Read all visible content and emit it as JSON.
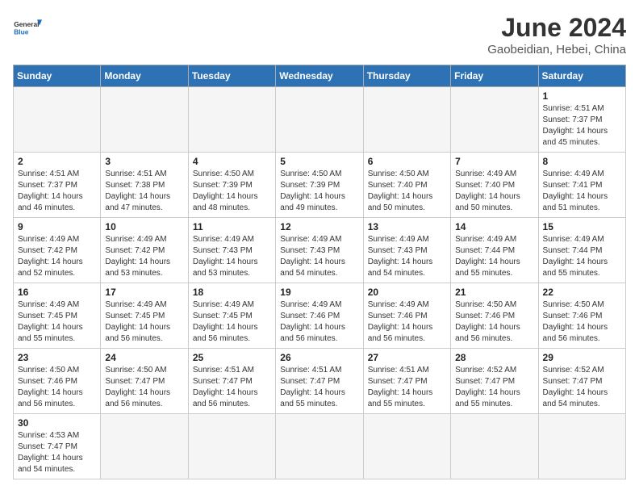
{
  "header": {
    "logo_general": "General",
    "logo_blue": "Blue",
    "title": "June 2024",
    "subtitle": "Gaobeidian, Hebei, China"
  },
  "days_of_week": [
    "Sunday",
    "Monday",
    "Tuesday",
    "Wednesday",
    "Thursday",
    "Friday",
    "Saturday"
  ],
  "weeks": [
    [
      {
        "day": "",
        "empty": true
      },
      {
        "day": "",
        "empty": true
      },
      {
        "day": "",
        "empty": true
      },
      {
        "day": "",
        "empty": true
      },
      {
        "day": "",
        "empty": true
      },
      {
        "day": "",
        "empty": true
      },
      {
        "day": "1",
        "sunrise": "4:51 AM",
        "sunset": "7:37 PM",
        "daylight": "14 hours and 45 minutes."
      }
    ],
    [
      {
        "day": "2",
        "sunrise": "4:51 AM",
        "sunset": "7:37 PM",
        "daylight": "14 hours and 46 minutes."
      },
      {
        "day": "3",
        "sunrise": "4:51 AM",
        "sunset": "7:38 PM",
        "daylight": "14 hours and 47 minutes."
      },
      {
        "day": "4",
        "sunrise": "4:50 AM",
        "sunset": "7:39 PM",
        "daylight": "14 hours and 48 minutes."
      },
      {
        "day": "5",
        "sunrise": "4:50 AM",
        "sunset": "7:39 PM",
        "daylight": "14 hours and 49 minutes."
      },
      {
        "day": "6",
        "sunrise": "4:50 AM",
        "sunset": "7:40 PM",
        "daylight": "14 hours and 50 minutes."
      },
      {
        "day": "7",
        "sunrise": "4:49 AM",
        "sunset": "7:40 PM",
        "daylight": "14 hours and 50 minutes."
      },
      {
        "day": "8",
        "sunrise": "4:49 AM",
        "sunset": "7:41 PM",
        "daylight": "14 hours and 51 minutes."
      }
    ],
    [
      {
        "day": "9",
        "sunrise": "4:49 AM",
        "sunset": "7:42 PM",
        "daylight": "14 hours and 52 minutes."
      },
      {
        "day": "10",
        "sunrise": "4:49 AM",
        "sunset": "7:42 PM",
        "daylight": "14 hours and 53 minutes."
      },
      {
        "day": "11",
        "sunrise": "4:49 AM",
        "sunset": "7:43 PM",
        "daylight": "14 hours and 53 minutes."
      },
      {
        "day": "12",
        "sunrise": "4:49 AM",
        "sunset": "7:43 PM",
        "daylight": "14 hours and 54 minutes."
      },
      {
        "day": "13",
        "sunrise": "4:49 AM",
        "sunset": "7:43 PM",
        "daylight": "14 hours and 54 minutes."
      },
      {
        "day": "14",
        "sunrise": "4:49 AM",
        "sunset": "7:44 PM",
        "daylight": "14 hours and 55 minutes."
      },
      {
        "day": "15",
        "sunrise": "4:49 AM",
        "sunset": "7:44 PM",
        "daylight": "14 hours and 55 minutes."
      }
    ],
    [
      {
        "day": "16",
        "sunrise": "4:49 AM",
        "sunset": "7:45 PM",
        "daylight": "14 hours and 55 minutes."
      },
      {
        "day": "17",
        "sunrise": "4:49 AM",
        "sunset": "7:45 PM",
        "daylight": "14 hours and 56 minutes."
      },
      {
        "day": "18",
        "sunrise": "4:49 AM",
        "sunset": "7:45 PM",
        "daylight": "14 hours and 56 minutes."
      },
      {
        "day": "19",
        "sunrise": "4:49 AM",
        "sunset": "7:46 PM",
        "daylight": "14 hours and 56 minutes."
      },
      {
        "day": "20",
        "sunrise": "4:49 AM",
        "sunset": "7:46 PM",
        "daylight": "14 hours and 56 minutes."
      },
      {
        "day": "21",
        "sunrise": "4:50 AM",
        "sunset": "7:46 PM",
        "daylight": "14 hours and 56 minutes."
      },
      {
        "day": "22",
        "sunrise": "4:50 AM",
        "sunset": "7:46 PM",
        "daylight": "14 hours and 56 minutes."
      }
    ],
    [
      {
        "day": "23",
        "sunrise": "4:50 AM",
        "sunset": "7:46 PM",
        "daylight": "14 hours and 56 minutes."
      },
      {
        "day": "24",
        "sunrise": "4:50 AM",
        "sunset": "7:47 PM",
        "daylight": "14 hours and 56 minutes."
      },
      {
        "day": "25",
        "sunrise": "4:51 AM",
        "sunset": "7:47 PM",
        "daylight": "14 hours and 56 minutes."
      },
      {
        "day": "26",
        "sunrise": "4:51 AM",
        "sunset": "7:47 PM",
        "daylight": "14 hours and 55 minutes."
      },
      {
        "day": "27",
        "sunrise": "4:51 AM",
        "sunset": "7:47 PM",
        "daylight": "14 hours and 55 minutes."
      },
      {
        "day": "28",
        "sunrise": "4:52 AM",
        "sunset": "7:47 PM",
        "daylight": "14 hours and 55 minutes."
      },
      {
        "day": "29",
        "sunrise": "4:52 AM",
        "sunset": "7:47 PM",
        "daylight": "14 hours and 54 minutes."
      }
    ],
    [
      {
        "day": "30",
        "sunrise": "4:53 AM",
        "sunset": "7:47 PM",
        "daylight": "14 hours and 54 minutes."
      },
      {
        "day": "",
        "empty": true
      },
      {
        "day": "",
        "empty": true
      },
      {
        "day": "",
        "empty": true
      },
      {
        "day": "",
        "empty": true
      },
      {
        "day": "",
        "empty": true
      },
      {
        "day": "",
        "empty": true
      }
    ]
  ]
}
